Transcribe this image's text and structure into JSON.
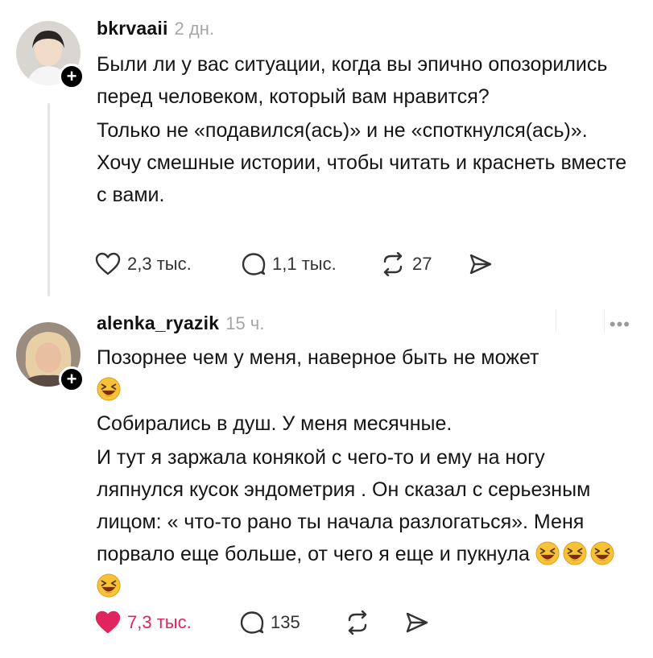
{
  "posts": [
    {
      "username": "bkrvaaii",
      "time": "2 дн.",
      "paragraphs": [
        "Были ли у вас ситуации, когда вы эпично опозорились перед человеком, который вам нравится?",
        "Только не «подавился(ась)» и не «споткнулся(ась)». Хочу смешные истории, чтобы читать и краснеть вместе с вами."
      ],
      "likes": "2,3 тыс.",
      "replies": "1,1 тыс.",
      "reposts": "27",
      "liked": false
    },
    {
      "username": "alenka_ryazik",
      "time": "15 ч.",
      "paragraphs": [
        "Позорнее чем у меня, наверное быть не может",
        "Собирались в душ. У меня месячные.",
        "И тут я заржала конякой с чего-то и ему на ногу ляпнулся кусок эндометрия . Он сказал с серьезным лицом: « что-то рано ты начала разлогаться». Меня порвало еще больше, от чего я еще и пукнула"
      ],
      "likes": "7,3 тыс.",
      "replies": "135",
      "reposts": "",
      "liked": true
    }
  ],
  "colors": {
    "like_active": "#e0245e",
    "timestamp": "#a6a6a6",
    "emoji_face": "#f7c235"
  },
  "icons": {
    "like": "heart-icon",
    "reply": "speech-bubble-icon",
    "repost": "repost-arrows-icon",
    "share": "send-arrow-icon",
    "more": "more-dots-icon",
    "emoji": "laughing-squint-emoji"
  }
}
